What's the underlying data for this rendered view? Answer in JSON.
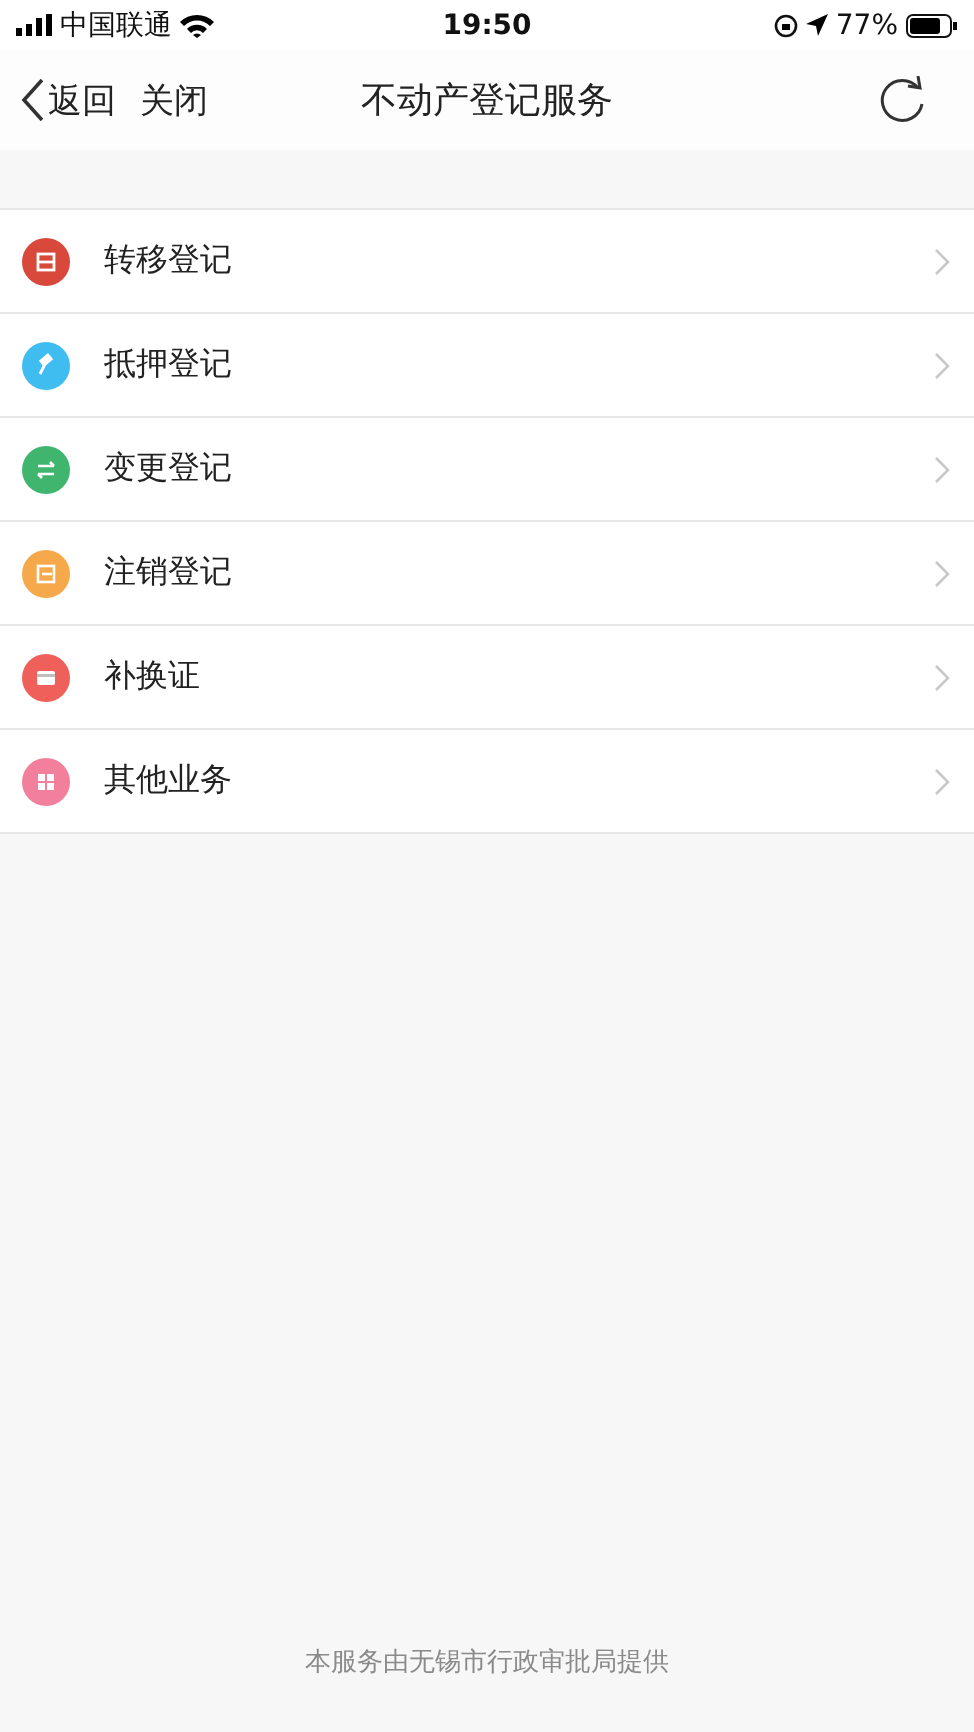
{
  "status_bar": {
    "carrier": "中国联通",
    "time": "19:50",
    "battery": "77%"
  },
  "nav": {
    "back": "返回",
    "close": "关闭",
    "title": "不动产登记服务"
  },
  "items": [
    {
      "label": "转移登记",
      "color": "#d8483b",
      "kind": "box"
    },
    {
      "label": "抵押登记",
      "color": "#3fbcf0",
      "kind": "hammer"
    },
    {
      "label": "变更登记",
      "color": "#3fb56e",
      "kind": "swap"
    },
    {
      "label": "注销登记",
      "color": "#f6a94a",
      "kind": "exit"
    },
    {
      "label": "补换证",
      "color": "#f0605a",
      "kind": "card"
    },
    {
      "label": "其他业务",
      "color": "#f27f9c",
      "kind": "grid"
    }
  ],
  "footer": "本服务由无锡市行政审批局提供"
}
